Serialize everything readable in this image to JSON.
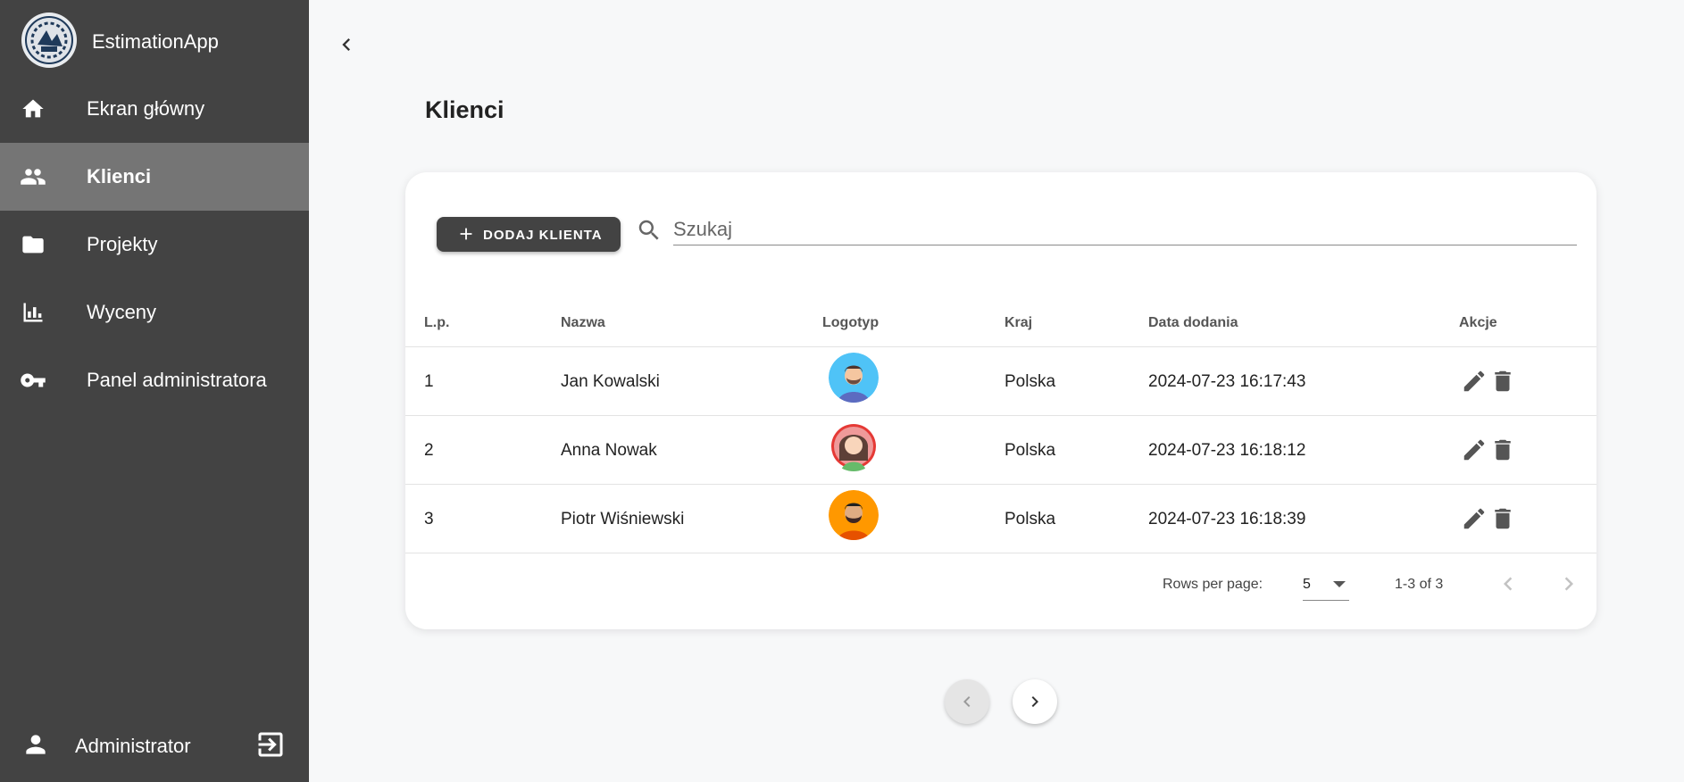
{
  "app": {
    "title": "EstimationApp"
  },
  "sidebar": {
    "items": [
      {
        "label": "Ekran główny",
        "icon": "home-icon"
      },
      {
        "label": "Klienci",
        "icon": "people-icon",
        "active": true
      },
      {
        "label": "Projekty",
        "icon": "folder-icon"
      },
      {
        "label": "Wyceny",
        "icon": "bar-chart-icon"
      },
      {
        "label": "Panel administratora",
        "icon": "key-icon"
      }
    ],
    "user": {
      "name": "Administrator",
      "icon": "person-icon",
      "logout_icon": "logout-icon"
    }
  },
  "page": {
    "title": "Klienci"
  },
  "toolbar": {
    "add_label": "DODAJ KLIENTA",
    "search_placeholder": "Szukaj"
  },
  "table": {
    "headers": {
      "lp": "L.p.",
      "name": "Nazwa",
      "logo": "Logotyp",
      "country": "Kraj",
      "date": "Data dodania",
      "actions": "Akcje"
    },
    "rows": [
      {
        "lp": "1",
        "name": "Jan Kowalski",
        "country": "Polska",
        "date": "2024-07-23 16:17:43",
        "avatar": "man-avatar-blue"
      },
      {
        "lp": "2",
        "name": "Anna Nowak",
        "country": "Polska",
        "date": "2024-07-23 16:18:12",
        "avatar": "woman-avatar-red"
      },
      {
        "lp": "3",
        "name": "Piotr Wiśniewski",
        "country": "Polska",
        "date": "2024-07-23 16:18:39",
        "avatar": "man-avatar-orange"
      }
    ]
  },
  "pagination": {
    "rows_per_page_label": "Rows per page:",
    "rows_per_page": "5",
    "range": "1-3 of 3"
  },
  "colors": {
    "sidebar": "#434343",
    "active": "#757575",
    "background": "#f7f8f9"
  }
}
